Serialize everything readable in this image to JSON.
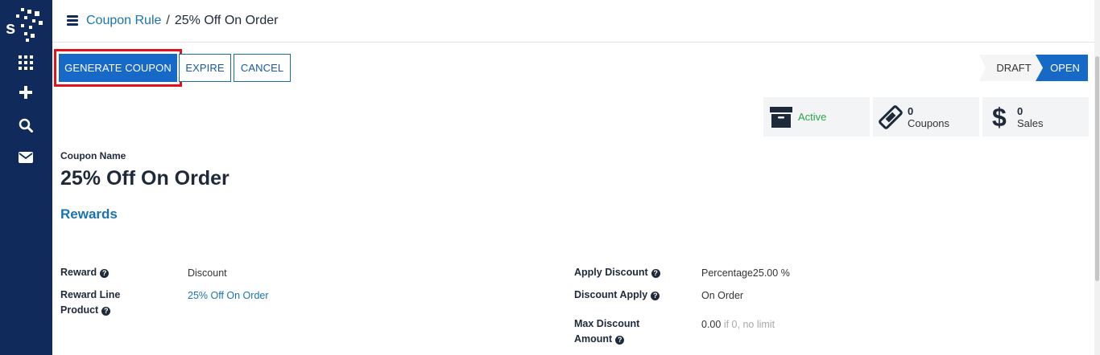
{
  "breadcrumb": {
    "parent": "Coupon Rule",
    "separator": "/",
    "current": "25% Off On Order"
  },
  "buttons": {
    "generate": "GENERATE COUPON",
    "expire": "EXPIRE",
    "cancel": "CANCEL"
  },
  "status_steps": [
    {
      "label": "DRAFT",
      "state": "inactive"
    },
    {
      "label": "OPEN",
      "state": "active"
    }
  ],
  "stats": {
    "active": {
      "label": "Active",
      "icon": "archive-icon"
    },
    "coupons": {
      "count": "0",
      "label": "Coupons",
      "icon": "ticket-icon"
    },
    "sales": {
      "count": "0",
      "label": "Sales",
      "icon": "dollar-icon"
    }
  },
  "form": {
    "name_label": "Coupon Name",
    "name": "25% Off On Order",
    "section": "Rewards",
    "fields_left": [
      {
        "label": "Reward",
        "value": "Discount"
      },
      {
        "label_line1": "Reward Line",
        "label_line2": "Product",
        "value": "25% Off On Order"
      }
    ],
    "fields_right": [
      {
        "label": "Apply Discount",
        "value": "Percentage25.00 %"
      },
      {
        "label": "Discount Apply",
        "value": "On Order"
      },
      {
        "label_line1": "Max Discount",
        "label_line2": "Amount",
        "value": "0.00",
        "hint": "if 0, no limit"
      }
    ],
    "help_glyph": "?"
  },
  "colors": {
    "sidebar": "#102a5c",
    "primary": "#1769c7",
    "link": "#1a73b0",
    "active_green": "#28a745",
    "highlight": "#e0131d"
  }
}
